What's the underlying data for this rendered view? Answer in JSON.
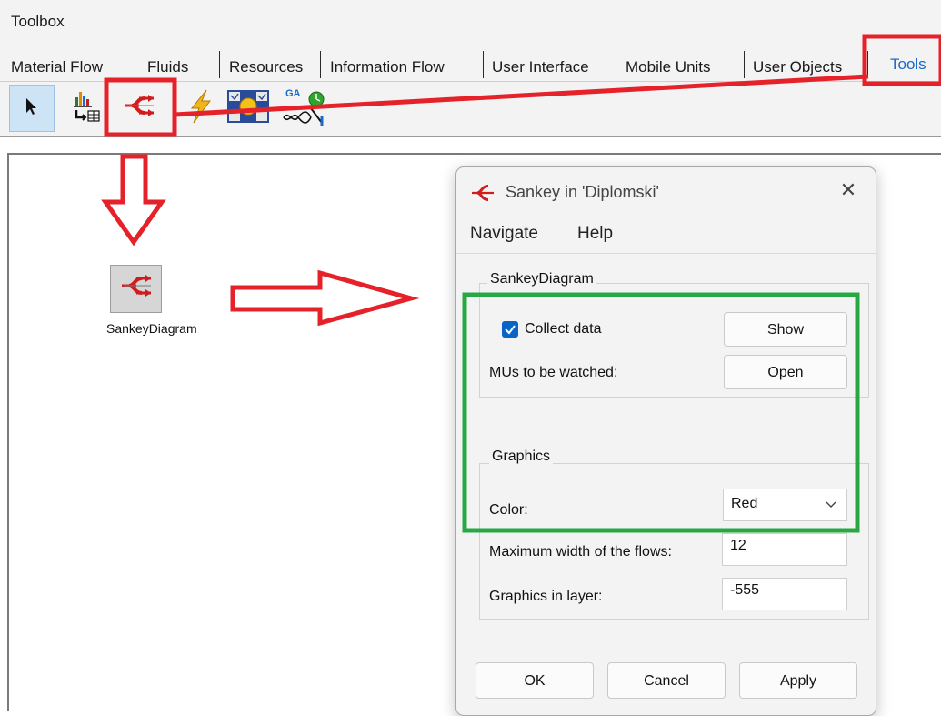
{
  "toolbox": {
    "title": "Toolbox",
    "tabs": [
      "Material Flow",
      "Fluids",
      "Resources",
      "Information Flow",
      "User Interface",
      "Mobile Units",
      "User Objects",
      "Tools"
    ],
    "active_tab": "Tools"
  },
  "toolbar": {
    "icons": [
      "pointer-arrow-icon",
      "chart-table-icon",
      "sankey-icon",
      "lightning-icon",
      "experiment-manager-icon",
      "genetic-algorithm-icon"
    ],
    "ga_text": "GA"
  },
  "canvas": {
    "object_label": "SankeyDiagram"
  },
  "dialog": {
    "title": "Sankey in 'Diplomski'",
    "close_glyph": "✕",
    "menu": [
      "Navigate",
      "Help"
    ],
    "group_sankey_label": "SankeyDiagram",
    "collect_data_label": "Collect data",
    "collect_data_checked": true,
    "show_button": "Show",
    "mus_label": "MUs to be watched:",
    "open_button": "Open",
    "group_graphics_label": "Graphics",
    "color_label": "Color:",
    "color_value": "Red",
    "max_width_label": "Maximum width of the flows:",
    "max_width_value": "12",
    "layer_label": "Graphics in layer:",
    "layer_value": "-555",
    "ok_button": "OK",
    "cancel_button": "Cancel",
    "apply_button": "Apply"
  },
  "colors": {
    "annotation_red": "#e5222a",
    "annotation_green": "#28a745",
    "accent_blue": "#1b69c8"
  }
}
